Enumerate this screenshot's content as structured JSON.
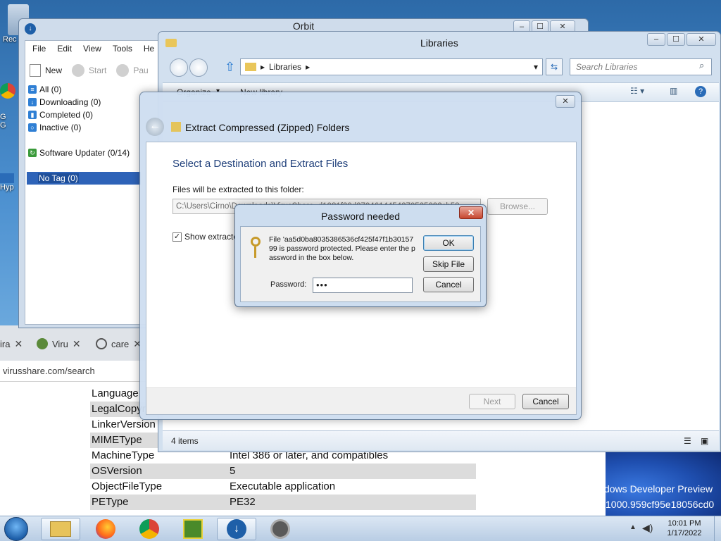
{
  "desktop": {
    "icon_labels": [
      "Rec",
      "G",
      "G",
      "Hyp"
    ],
    "windows_preview": {
      "line1": "dows Developer Preview",
      "line2": "1000.959cf95e18056cd0"
    }
  },
  "browser": {
    "tabs": [
      {
        "label": "ira",
        "close": "✕"
      },
      {
        "label": "Viru",
        "close": "✕"
      },
      {
        "label": "care",
        "close": "✕"
      }
    ],
    "url": "virusshare.com/search",
    "rows": [
      {
        "key": "Language",
        "value": ""
      },
      {
        "key": "LegalCopyright",
        "value": ""
      },
      {
        "key": "LinkerVersion",
        "value": ""
      },
      {
        "key": "MIMEType",
        "value": ""
      },
      {
        "key": "MachineType",
        "value": "Intel 386 or later, and compatibles"
      },
      {
        "key": "OSVersion",
        "value": "5"
      },
      {
        "key": "ObjectFileType",
        "value": "Executable application"
      },
      {
        "key": "PEType",
        "value": "PE32"
      }
    ]
  },
  "orbit": {
    "title": "Orbit",
    "menu": [
      "File",
      "Edit",
      "View",
      "Tools",
      "He"
    ],
    "toolbar": {
      "new": "New",
      "start": "Start",
      "pause": "Pau"
    },
    "categories": [
      {
        "label": "All (0)",
        "icon": "list-icon"
      },
      {
        "label": "Downloading (0)",
        "icon": "download-icon"
      },
      {
        "label": "Completed (0)",
        "icon": "completed-icon"
      },
      {
        "label": "Inactive (0)",
        "icon": "inactive-icon"
      }
    ],
    "updater": "Software Updater (0/14)",
    "tag": "No Tag (0)"
  },
  "libraries": {
    "title": "Libraries",
    "address": "Libraries",
    "search_placeholder": "Search Libraries",
    "organize": "Organize",
    "new_library": "New library",
    "status": "4 items",
    "caption": {
      "min": "–",
      "max": "☐",
      "close": "✕"
    }
  },
  "wizard": {
    "title": "Extract Compressed (Zipped) Folders",
    "heading": "Select a Destination and Extract Files",
    "folder_label": "Files will be extracted to this folder:",
    "path": "C:\\Users\\Cirno\\Downloads\\VirusShare_d1081f20d270461445427052509​2cb58",
    "browse": "Browse...",
    "show_label": "Show extracte",
    "next": "Next",
    "cancel": "Cancel",
    "close": "✕"
  },
  "password": {
    "title": "Password needed",
    "message": "File 'aa5d0ba8035386536cf425f47f1b3015799 is password protected.  Please enter the password in the box below.",
    "label": "Password:",
    "value": "•••",
    "ok": "OK",
    "skip": "Skip File",
    "cancel": "Cancel",
    "close": "✕"
  },
  "taskbar": {
    "time": "10:01 PM",
    "date": "1/17/2022"
  },
  "colors": {
    "accent": "#2e63b8",
    "titlebar": "#d2e0ef",
    "close_red": "#c7462f"
  }
}
